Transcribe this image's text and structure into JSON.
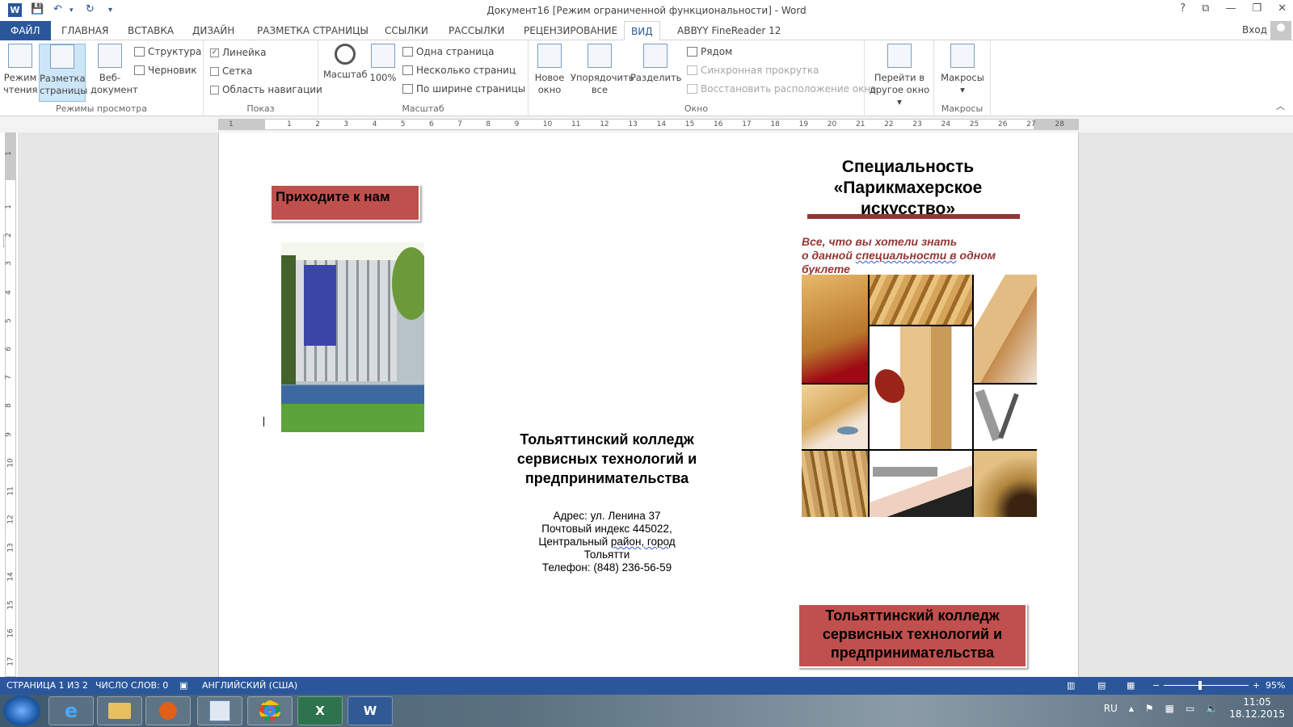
{
  "titlebar": {
    "title": "Документ16 [Режим ограниченной функциональности] - Word",
    "buttons": [
      "?",
      "⧉",
      "—",
      "❐",
      "✕"
    ]
  },
  "tabs": {
    "file": "ФАЙЛ",
    "items": [
      "ГЛАВНАЯ",
      "ВСТАВКА",
      "ДИЗАЙН",
      "РАЗМЕТКА СТРАНИЦЫ",
      "ССЫЛКИ",
      "РАССЫЛКИ",
      "РЕЦЕНЗИРОВАНИЕ",
      "ВИД",
      "ABBYY FineReader 12"
    ],
    "active": "ВИД",
    "signin": "Вход"
  },
  "ribbon": {
    "views": {
      "label": "Режимы просмотра",
      "read_mode": "Режим чтения",
      "print_layout": "Разметка страницы",
      "web_layout": "Веб-документ",
      "outline": "Структура",
      "draft": "Черновик"
    },
    "show": {
      "label": "Показ",
      "ruler": "Линейка",
      "ruler_checked": true,
      "gridlines": "Сетка",
      "nav_pane": "Область навигации"
    },
    "zoom": {
      "label": "Масштаб",
      "zoom": "Масштаб",
      "hundred": "100%",
      "one_page": "Одна страница",
      "multi_page": "Несколько страниц",
      "page_width": "По ширине страницы"
    },
    "window": {
      "label": "Окно",
      "new_window": "Новое окно",
      "arrange_all": "Упорядочить все",
      "split": "Разделить",
      "side_by_side": "Рядом",
      "sync_scroll": "Синхронная прокрутка",
      "reset_pos": "Восстановить расположение окна",
      "switch_windows": "Перейти в другое окно"
    },
    "macros": {
      "label": "Макросы",
      "macros": "Макросы"
    }
  },
  "ruler": {
    "h_ticks": [
      "1",
      "1",
      "2",
      "3",
      "4",
      "5",
      "6",
      "7",
      "8",
      "9",
      "10",
      "11",
      "12",
      "13",
      "14",
      "15",
      "16",
      "17",
      "18",
      "19",
      "20",
      "21",
      "22",
      "23",
      "24",
      "25",
      "26",
      "27",
      "28"
    ],
    "v_ticks": [
      "1",
      "1",
      "2",
      "3",
      "4",
      "5",
      "6",
      "7",
      "8",
      "9",
      "10",
      "11",
      "12",
      "13",
      "14",
      "15",
      "16",
      "17"
    ],
    "corner": "L"
  },
  "document": {
    "come_to_us": "Приходите к нам",
    "college_title": "Тольяттинский колледж сервисных технологий и предпринимательства",
    "address_line1": "Адрес: ул. Ленина 37",
    "address_line2": "Почтовый индекс 445022,",
    "address_line3a": "Центральный ",
    "address_line3b": "район,  город",
    "address_line4": "Тольятти",
    "phone": "Телефон: (848) 236-56-59",
    "specialty_title": "Специальность «Парикмахерское искусство»",
    "subtitle_a": "Все, что вы хотели знать",
    "subtitle_b1": "о данной ",
    "subtitle_b2": "специальности  в",
    "subtitle_b3": " одном",
    "subtitle_c": "буклете",
    "college_box": "Тольяттинский колледж сервисных технологий и предпринимательства",
    "accent_color": "#c0504d",
    "dark_red": "#943634"
  },
  "statusbar": {
    "page": "СТРАНИЦА 1 ИЗ 2",
    "words": "ЧИСЛО СЛОВ: 0",
    "language": "АНГЛИЙСКИЙ (США)",
    "zoom": "95%",
    "zoom_value": 95
  },
  "taskbar": {
    "lang": "RU",
    "time": "11:05",
    "date": "18.12.2015",
    "apps": [
      "ie-icon",
      "explorer-icon",
      "media-player-icon",
      "tray-app-icon",
      "chrome-icon",
      "excel-icon",
      "word-icon"
    ]
  }
}
